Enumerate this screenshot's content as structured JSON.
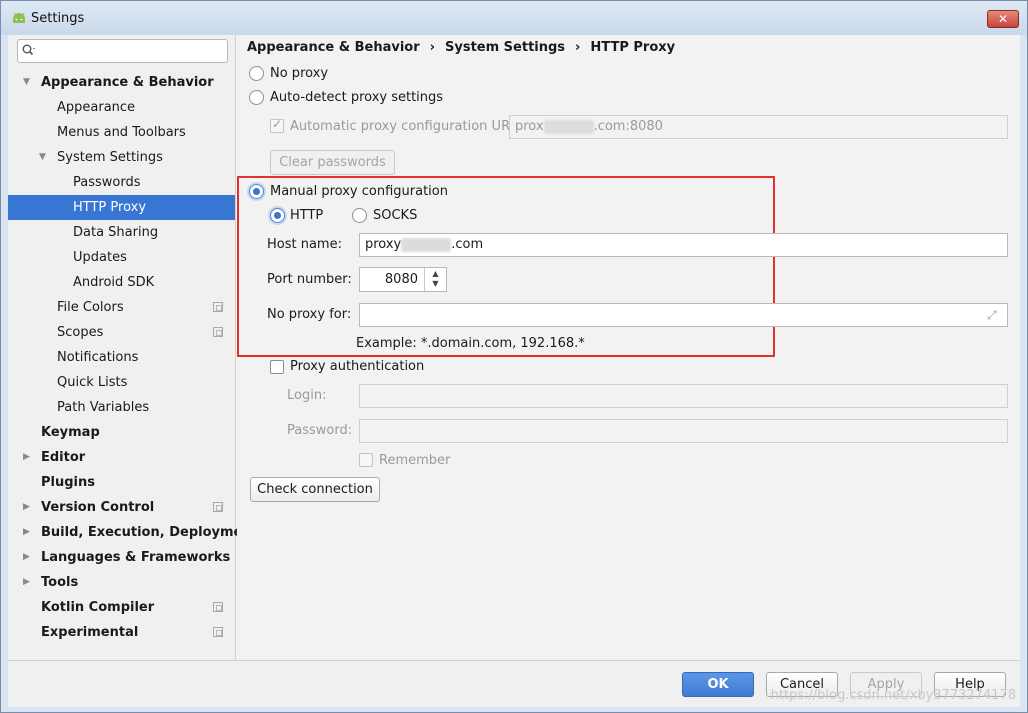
{
  "window": {
    "title": "Settings",
    "close_label": "✕"
  },
  "search": {
    "placeholder": ""
  },
  "sidebar": {
    "items": [
      {
        "label": "Appearance & Behavior"
      },
      {
        "label": "Appearance"
      },
      {
        "label": "Menus and Toolbars"
      },
      {
        "label": "System Settings"
      },
      {
        "label": "Passwords"
      },
      {
        "label": "HTTP Proxy"
      },
      {
        "label": "Data Sharing"
      },
      {
        "label": "Updates"
      },
      {
        "label": "Android SDK"
      },
      {
        "label": "File Colors"
      },
      {
        "label": "Scopes"
      },
      {
        "label": "Notifications"
      },
      {
        "label": "Quick Lists"
      },
      {
        "label": "Path Variables"
      },
      {
        "label": "Keymap"
      },
      {
        "label": "Editor"
      },
      {
        "label": "Plugins"
      },
      {
        "label": "Version Control"
      },
      {
        "label": "Build, Execution, Deployment"
      },
      {
        "label": "Languages & Frameworks"
      },
      {
        "label": "Tools"
      },
      {
        "label": "Kotlin Compiler"
      },
      {
        "label": "Experimental"
      }
    ]
  },
  "breadcrumb": {
    "part1": "Appearance & Behavior",
    "part2": "System Settings",
    "part3": "HTTP Proxy",
    "sep": "›"
  },
  "proxy": {
    "no_proxy": "No proxy",
    "auto_detect": "Auto-detect proxy settings",
    "auto_url_label": "Automatic proxy configuration URL:",
    "auto_url_prefix": "prox",
    "auto_url_suffix": ".com:8080",
    "clear_passwords": "Clear passwords",
    "manual": "Manual proxy configuration",
    "http": "HTTP",
    "socks": "SOCKS",
    "host_label": "Host name:",
    "host_prefix": "proxy",
    "host_suffix": ".com",
    "port_label": "Port number:",
    "port_value": "8080",
    "no_proxy_for_label": "No proxy for:",
    "no_proxy_for_value": "",
    "example": "Example: *.domain.com, 192.168.*",
    "auth_label": "Proxy authentication",
    "login_label": "Login:",
    "password_label": "Password:",
    "remember_label": "Remember",
    "check_connection": "Check connection"
  },
  "footer": {
    "ok": "OK",
    "cancel": "Cancel",
    "apply": "Apply",
    "help": "Help",
    "watermark": "https://blog.csdn.net/xby3773274178"
  },
  "colors": {
    "selection": "#3876d4",
    "highlight_box": "#e2302f",
    "primary_button": "#4a86d8"
  }
}
